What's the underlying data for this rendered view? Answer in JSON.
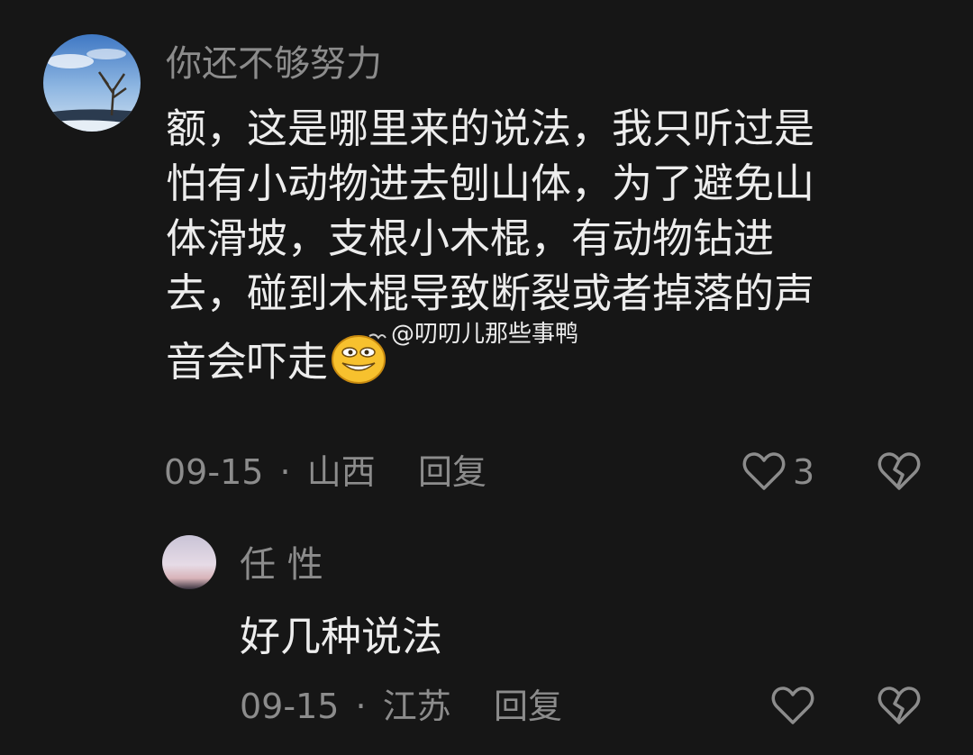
{
  "comment": {
    "username": "你还不够努力",
    "lines": [
      "额，这是哪里来的说法，我只听过是",
      "怕有小动物进去刨山体，为了避免山",
      "体滑坡，支根小木棍，有动物钻进",
      "去，碰到木棍导致断裂或者掉落的声",
      "音会吓走"
    ],
    "emoji_icon": "grinning-emoji-icon",
    "watermark": "@叨叨儿那些事鸭",
    "date": "09-15",
    "separator": "·",
    "location": "山西",
    "reply_label": "回复",
    "like_count": "3"
  },
  "sub_reply": {
    "username": "任 性",
    "text": "好几种说法",
    "date": "09-15",
    "separator": "·",
    "location": "江苏",
    "reply_label": "回复"
  },
  "colors": {
    "background": "#161616",
    "text_primary": "#ededed",
    "text_secondary": "#8c8c8c"
  }
}
